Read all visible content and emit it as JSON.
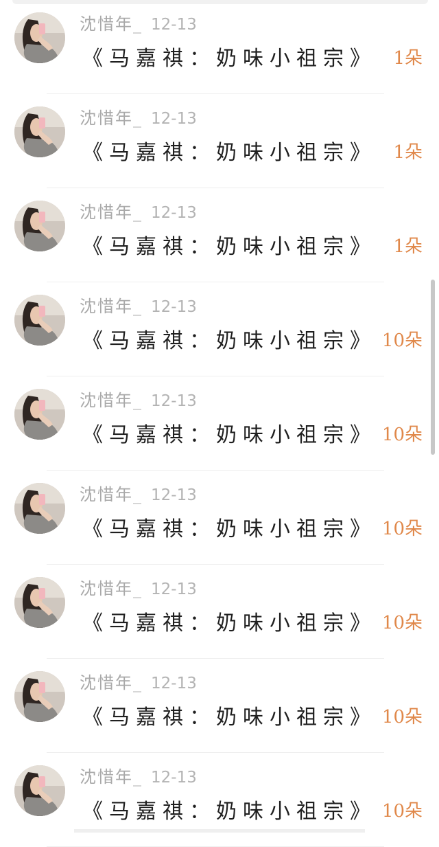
{
  "colors": {
    "username": "#a9a9a9",
    "date": "#b3b3b3",
    "title": "#1f1f1f",
    "count_accent": "#e0884a",
    "divider": "#eeeeee",
    "scrollbar": "#c7c7c7"
  },
  "items": [
    {
      "username": "沈惜年_",
      "date": "12-13",
      "title": "《马嘉祺：奶味小祖宗》",
      "count": "1朵"
    },
    {
      "username": "沈惜年_",
      "date": "12-13",
      "title": "《马嘉祺：奶味小祖宗》",
      "count": "1朵"
    },
    {
      "username": "沈惜年_",
      "date": "12-13",
      "title": "《马嘉祺：奶味小祖宗》",
      "count": "1朵"
    },
    {
      "username": "沈惜年_",
      "date": "12-13",
      "title": "《马嘉祺：奶味小祖宗》",
      "count": "10朵"
    },
    {
      "username": "沈惜年_",
      "date": "12-13",
      "title": "《马嘉祺：奶味小祖宗》",
      "count": "10朵"
    },
    {
      "username": "沈惜年_",
      "date": "12-13",
      "title": "《马嘉祺：奶味小祖宗》",
      "count": "10朵"
    },
    {
      "username": "沈惜年_",
      "date": "12-13",
      "title": "《马嘉祺：奶味小祖宗》",
      "count": "10朵"
    },
    {
      "username": "沈惜年_",
      "date": "12-13",
      "title": "《马嘉祺：奶味小祖宗》",
      "count": "10朵"
    },
    {
      "username": "沈惜年_",
      "date": "12-13",
      "title": "《马嘉祺：奶味小祖宗》",
      "count": "10朵"
    }
  ]
}
